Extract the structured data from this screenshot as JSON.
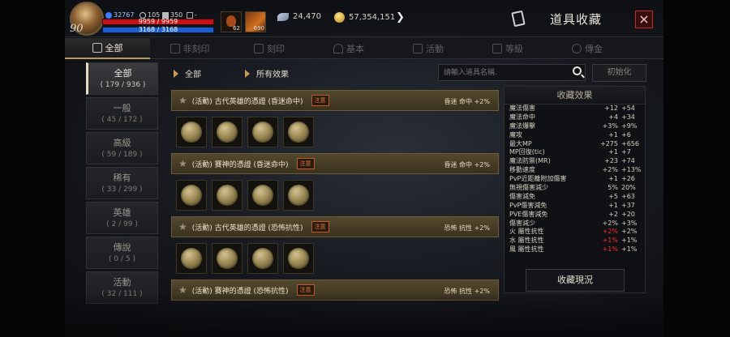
{
  "hud": {
    "level": "90",
    "stat1": "32767",
    "stat2": "105",
    "stat3": "350",
    "stat4": "-",
    "hp": "9959 / 9959",
    "mp": "3168 / 3168",
    "buff1_count": "62",
    "buff2_count": "690",
    "feather_amount": "24,470",
    "gold_amount": "57,354,151",
    "title": "道具收藏",
    "close_label": "×"
  },
  "tabs": [
    {
      "label": "全部",
      "icon": "bookmark-icon"
    },
    {
      "label": "非刻印",
      "icon": "mask-icon"
    },
    {
      "label": "刻印",
      "icon": "mask-icon"
    },
    {
      "label": "基本",
      "icon": "horseshoe-icon"
    },
    {
      "label": "活動",
      "icon": "gift-icon"
    },
    {
      "label": "等級",
      "icon": "level-icon"
    },
    {
      "label": "傳金",
      "icon": "star-icon"
    }
  ],
  "categories": [
    {
      "label": "全部",
      "count": "( 179 / 936 )"
    },
    {
      "label": "一般",
      "count": "( 45 / 172 )"
    },
    {
      "label": "高級",
      "count": "( 59 / 189 )"
    },
    {
      "label": "稀有",
      "count": "( 33 / 299 )"
    },
    {
      "label": "英雄",
      "count": "( 2 / 99 )"
    },
    {
      "label": "傳說",
      "count": "( 0 / 5 )"
    },
    {
      "label": "活動",
      "count": "( 32 / 111 )"
    }
  ],
  "filters": {
    "category": "全部",
    "effect": "所有效果"
  },
  "search": {
    "placeholder": "請輸入道具名稱."
  },
  "reset_label": "初始化",
  "groups": [
    {
      "name": "(活動) 古代英雄的憑證 (昏迷命中)",
      "tag": "注意",
      "stat": "昏迷 命中 +2%"
    },
    {
      "name": "(活動) 賽神的憑證 (昏迷命中)",
      "tag": "注意",
      "stat": "昏迷 命中 +2%"
    },
    {
      "name": "(活動) 古代英雄的憑證 (恐怖抗性)",
      "tag": "注意",
      "stat": "恐怖 抗性 +2%"
    },
    {
      "name": "(活動) 賽神的憑證 (恐怖抗性)",
      "tag": "注意",
      "stat": "恐怖 抗性 +2%"
    }
  ],
  "effects_panel": {
    "title": "收藏效果",
    "rows": [
      {
        "name": "魔法傷害",
        "v1": "+12",
        "v2": "+54"
      },
      {
        "name": "魔法命中",
        "v1": "+4",
        "v2": "+34"
      },
      {
        "name": "魔法爆擊",
        "v1": "+3%",
        "v2": "+9%"
      },
      {
        "name": "魔攻",
        "v1": "+1",
        "v2": "+6"
      },
      {
        "name": "最大MP",
        "v1": "+275",
        "v2": "+656"
      },
      {
        "name": "MP回復(tic)",
        "v1": "+1",
        "v2": "+7"
      },
      {
        "name": "魔法防禦(MR)",
        "v1": "+23",
        "v2": "+74"
      },
      {
        "name": "移動速度",
        "v1": "+2%",
        "v2": "+13%"
      },
      {
        "name": "PvP近距離附加傷害",
        "v1": "+1",
        "v2": "+26"
      },
      {
        "name": "無視傷害減少",
        "v1": "5%",
        "v2": "20%"
      },
      {
        "name": "傷害減免",
        "v1": "+5",
        "v2": "+63"
      },
      {
        "name": "PvP傷害減免",
        "v1": "+1",
        "v2": "+37"
      },
      {
        "name": "PVE傷害減免",
        "v1": "+2",
        "v2": "+20"
      },
      {
        "name": "傷害減少",
        "v1": "+2%",
        "v2": "+3%"
      },
      {
        "name": "火 屬性抗性",
        "v1": "+2%",
        "v2": "+2%",
        "red": true
      },
      {
        "name": "水 屬性抗性",
        "v1": "+1%",
        "v2": "+1%",
        "red": true
      },
      {
        "name": "風 屬性抗性",
        "v1": "+1%",
        "v2": "+1%",
        "red": true
      }
    ],
    "status_button": "收藏現況"
  },
  "colors": {
    "accent": "#b79b5e",
    "hp": "#c21218",
    "mp": "#1d5ecc",
    "close": "#c62a2a"
  }
}
